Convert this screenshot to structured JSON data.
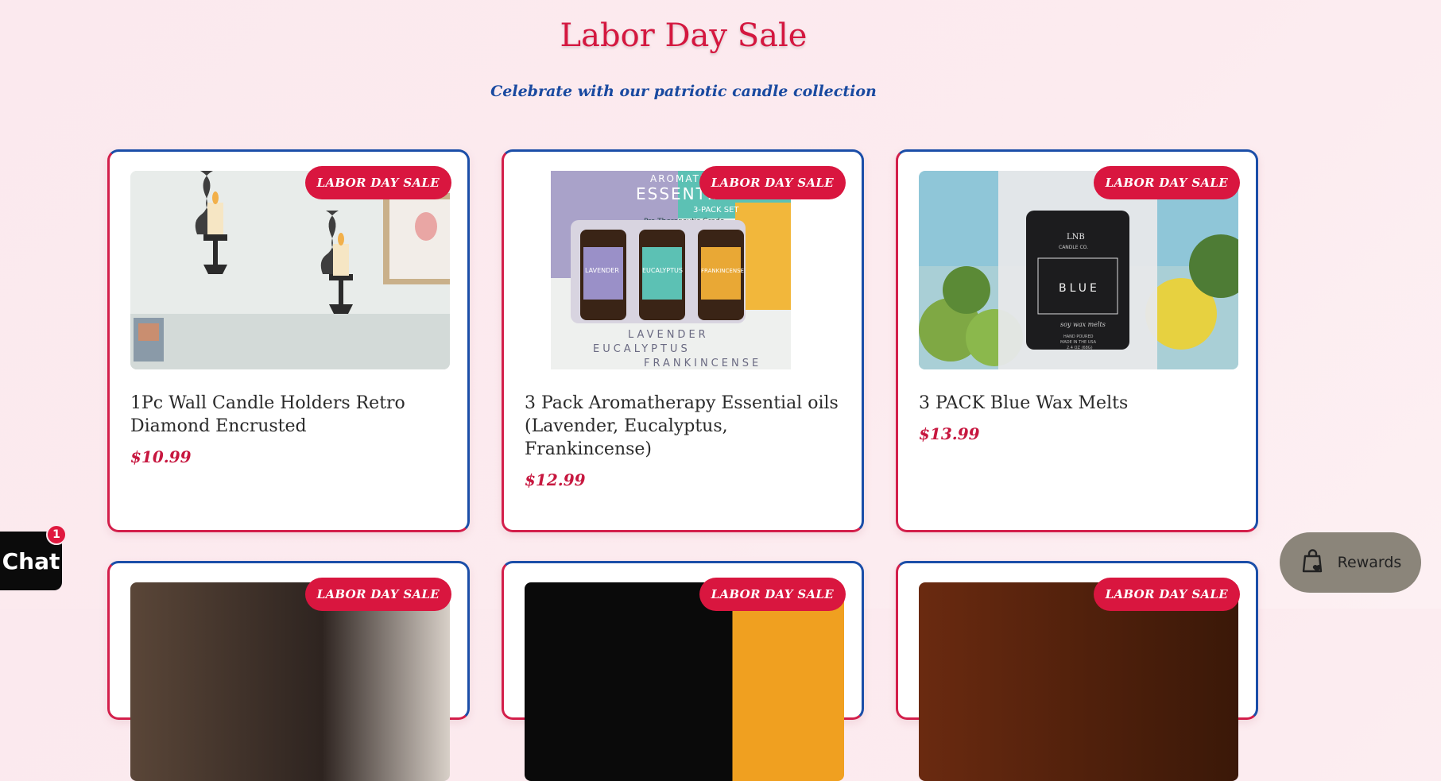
{
  "header": {
    "title": "Labor Day Sale",
    "subtitle": "Celebrate with our patriotic candle collection"
  },
  "badge_label": "LABOR DAY SALE",
  "products": [
    {
      "name": "1Pc Wall Candle Holders Retro Diamond Encrusted",
      "price": "$10.99"
    },
    {
      "name": "3 Pack Aromatherapy Essential oils (Lavender, Eucalyptus, Frankincense)",
      "price": "$12.99"
    },
    {
      "name": "3 PACK Blue Wax Melts",
      "price": "$13.99"
    }
  ],
  "product_images": {
    "oils": {
      "top_line": "AROMATHER",
      "brand": "ESSENTIAL",
      "pack": "3-PACK SET",
      "grade": "Pre Therapeutic Grade",
      "bottles": [
        "LAVENDER",
        "EUCALYPTUS",
        "FRANKINCENSE"
      ],
      "bottom_lines": [
        "LAVENDER",
        "EUCALYPTUS",
        "FRANKINCENSE"
      ]
    },
    "wax": {
      "brand": "LNB",
      "company": "CANDLE CO.",
      "scent": "BLUE",
      "script": "soy wax melts",
      "footer1": "HAND POURED",
      "footer2": "MADE IN THE USA",
      "footer3": "2.4 OZ (68G)"
    }
  },
  "chat": {
    "label": "Chat",
    "count": "1"
  },
  "rewards": {
    "label": "Rewards",
    "icon": "shopping-bag-heart-icon"
  },
  "colors": {
    "accent_red": "#d9163f",
    "accent_blue": "#1a4aa0",
    "background": "#fbe9ee"
  }
}
